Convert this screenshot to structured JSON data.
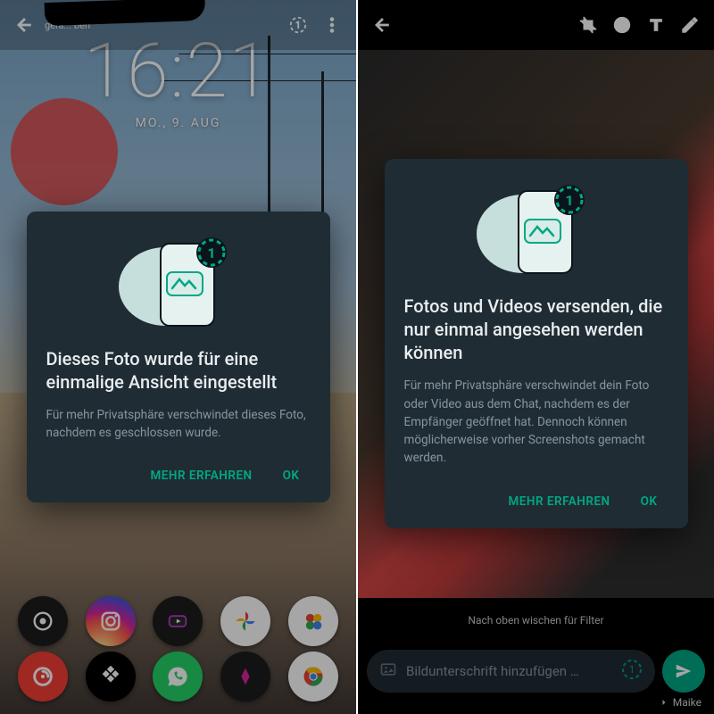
{
  "accent": "#00a884",
  "left": {
    "presence": "gera...       ben",
    "clock_time": "16:21",
    "clock_date": "MO., 9. AUG",
    "dialog": {
      "title": "Dieses Foto wurde für eine einmalige Ansicht eingestellt",
      "body": "Für mehr Privatsphäre verschwindet dieses Foto, nachdem es geschlossen wurde.",
      "learn_more": "MEHR ERFAHREN",
      "ok": "OK"
    },
    "dock_row1": [
      "camera",
      "instagram",
      "youtube",
      "photos",
      "google-go"
    ],
    "dock_row2": [
      "pocketcasts",
      "tidal",
      "whatsapp",
      "podcast",
      "chrome"
    ]
  },
  "right": {
    "dialog": {
      "title": "Fotos und Videos versenden, die nur einmal angesehen werden können",
      "body": "Für mehr Privatsphäre verschwindet dein Foto oder Video aus dem Chat, nachdem es der Empfänger geöffnet hat. Dennoch können möglicherweise vorher Screenshots gemacht werden.",
      "learn_more": "MEHR ERFAHREN",
      "ok": "OK"
    },
    "filter_hint": "Nach oben wischen für Filter",
    "caption_placeholder": "Bildunterschrift hinzufügen …",
    "recipient": "Maike"
  }
}
